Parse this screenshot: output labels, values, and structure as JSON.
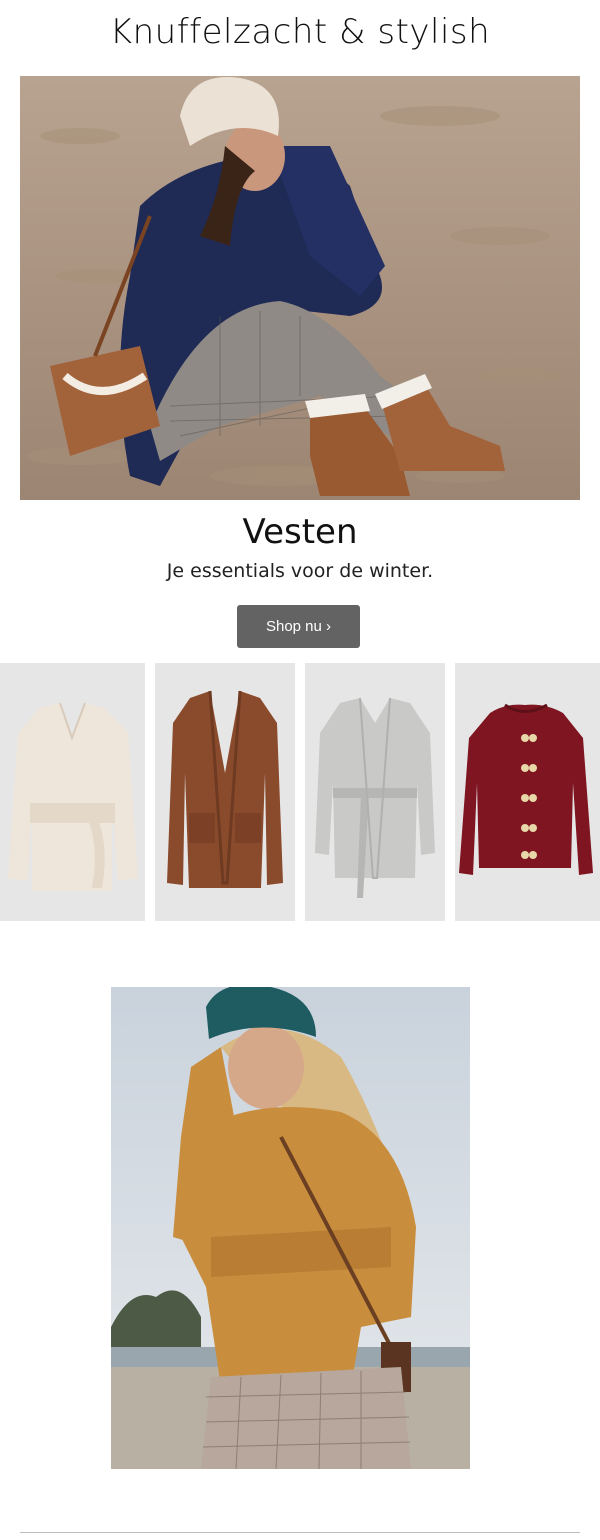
{
  "header": {
    "title": "Knuffelzacht & stylish"
  },
  "hero": {
    "image": "woman-sitting-on-sand-in-navy-cardigan-photo"
  },
  "section": {
    "title": "Vesten",
    "subtitle": "Je essentials voor de winter.",
    "button_label": "Shop nu ›"
  },
  "products": [
    {
      "image": "cream-wrap-cardigan-photo",
      "color": "#efe6db"
    },
    {
      "image": "brown-long-open-cardigan-photo",
      "color": "#8a4a2c"
    },
    {
      "image": "grey-belted-long-cardigan-photo",
      "color": "#c9c9c7"
    },
    {
      "image": "burgundy-buttoned-cardigan-photo",
      "color": "#7e1520"
    }
  ],
  "lifestyle": {
    "image": "woman-in-mustard-cardigan-and-teal-beanie-photo"
  },
  "colors": {
    "button_bg": "#636363",
    "tile_bg": "#e6e6e6",
    "divider": "#bdbdbd"
  }
}
